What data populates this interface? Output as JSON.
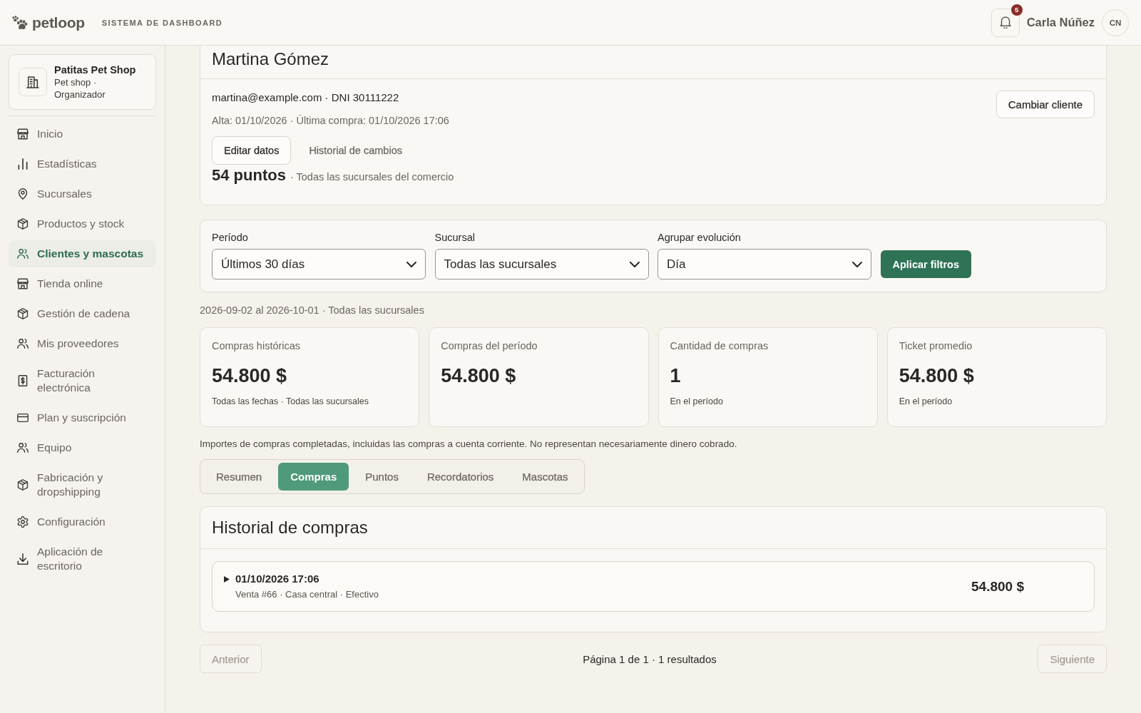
{
  "topbar": {
    "logo": "petloop",
    "title": "SISTEMA DE DASHBOARD",
    "notifications": {
      "count": "5"
    },
    "user": {
      "name": "Carla Núñez",
      "initials": "CN"
    }
  },
  "sidebar": {
    "organization": {
      "name": "Patitas Pet Shop",
      "detail": "Pet shop · Organizador"
    },
    "items": [
      {
        "label": "Inicio",
        "selected": false
      },
      {
        "label": "Estadísticas",
        "selected": false
      },
      {
        "label": "Sucursales",
        "selected": false
      },
      {
        "label": "Productos y stock",
        "selected": false
      },
      {
        "label": "Clientes y mascotas",
        "selected": true
      },
      {
        "label": "Tienda online",
        "selected": false
      },
      {
        "label": "Gestión de cadena",
        "selected": false
      },
      {
        "label": "Mis proveedores",
        "selected": false
      },
      {
        "label": "Facturación electrónica",
        "selected": false
      },
      {
        "label": "Plan y suscripción",
        "selected": false
      },
      {
        "label": "Equipo",
        "selected": false
      },
      {
        "label": "Fabricación y dropshipping",
        "selected": false
      },
      {
        "label": "Configuración",
        "selected": false
      },
      {
        "label": "Aplicación de escritorio",
        "selected": false
      }
    ]
  },
  "customer": {
    "name": "Martina Gómez",
    "contact": "martina@example.com · DNI 30111222",
    "dates": "Alta: 01/10/2026 · Última compra: 01/10/2026 17:06",
    "actions": [
      {
        "label": "Editar datos",
        "kind": "outlined"
      },
      {
        "label": "Historial de cambios",
        "kind": "plain"
      }
    ],
    "points": "54 puntos",
    "points_scope": "· Todas las sucursales del comercio",
    "change_button": "Cambiar cliente"
  },
  "filters": {
    "fields": [
      {
        "label": "Período",
        "value": "Últimos 30 días"
      },
      {
        "label": "Sucursal",
        "value": "Todas las sucursales"
      },
      {
        "label": "Agrupar evolución",
        "value": "Día"
      }
    ],
    "apply_button": "Aplicar filtros"
  },
  "range": "2026-09-02 al 2026-10-01 · Todas las sucursales",
  "stats": [
    {
      "label": "Compras históricas",
      "value": "54.800 $",
      "note": "Todas las fechas · Todas las sucursales"
    },
    {
      "label": "Compras del período",
      "value": "54.800 $"
    },
    {
      "label": "Cantidad de compras",
      "value": "1",
      "note": "En el período"
    },
    {
      "label": "Ticket promedio",
      "value": "54.800 $",
      "note": "En el período"
    }
  ],
  "footnote": "Importes de compras completadas, incluidas las compras a cuenta corriente. No representan necesariamente dinero cobrado.",
  "tabs": [
    {
      "label": "Resumen",
      "selected": false
    },
    {
      "label": "Compras",
      "selected": true
    },
    {
      "label": "Puntos",
      "selected": false
    },
    {
      "label": "Recordatorios",
      "selected": false
    },
    {
      "label": "Mascotas",
      "selected": false
    }
  ],
  "history": {
    "title": "Historial de compras",
    "entries": [
      {
        "date": "01/10/2026 17:06",
        "detail": "Venta #66 · Casa central · Efectivo",
        "amount": "54.800 $",
        "expanded": false
      }
    ]
  },
  "pagination": {
    "previous": {
      "label": "Anterior",
      "disabled": true
    },
    "status": "Página 1 de 1 · 1 resultados",
    "next": {
      "label": "Siguiente",
      "disabled": true
    }
  }
}
